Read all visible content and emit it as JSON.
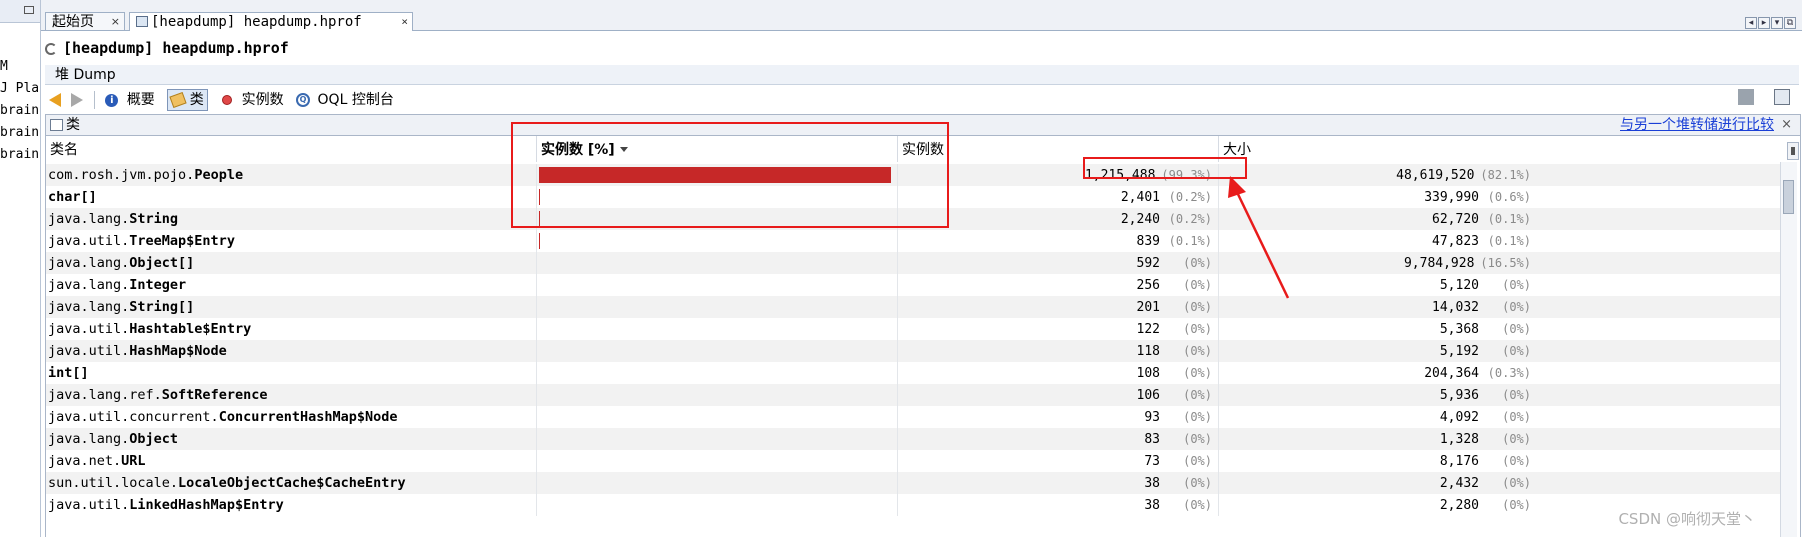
{
  "left_panel": {
    "items": [
      "M",
      "J Pla",
      "brain",
      "brain",
      "brain"
    ]
  },
  "tabs": [
    {
      "label": "起始页",
      "close": "×"
    },
    {
      "label": "[heapdump] heapdump.hprof",
      "close": "×"
    }
  ],
  "tab_nav": [
    "◂",
    "▸",
    "▾",
    "⧉"
  ],
  "window": {
    "title": "[heapdump] heapdump.hprof",
    "subtab": "堆 Dump"
  },
  "toolbar": {
    "summary_label": "概要",
    "classes_label": "类",
    "instances_label": "实例数",
    "oql_label": "OQL 控制台"
  },
  "panel": {
    "title": "类",
    "compare_link": "与另一个堆转储进行比较",
    "close": "×"
  },
  "table": {
    "headers": {
      "name": "类名",
      "instances_pct": "实例数 [%]",
      "instances": "实例数",
      "size": "大小"
    },
    "rows": [
      {
        "pkg": "com.rosh.jvm.pojo.",
        "cls": "People",
        "pct_bar": 99.3,
        "count": "1,215,488",
        "count_pct": "(99.3%)",
        "size": "48,619,520",
        "size_pct": "(82.1%)"
      },
      {
        "pkg": "",
        "cls": "char[]",
        "pct_bar": 0.2,
        "count": "2,401",
        "count_pct": "(0.2%)",
        "size": "339,990",
        "size_pct": "(0.6%)"
      },
      {
        "pkg": "java.lang.",
        "cls": "String",
        "pct_bar": 0.2,
        "count": "2,240",
        "count_pct": "(0.2%)",
        "size": "62,720",
        "size_pct": "(0.1%)"
      },
      {
        "pkg": "java.util.",
        "cls": "TreeMap$Entry",
        "pct_bar": 0.1,
        "count": "839",
        "count_pct": "(0.1%)",
        "size": "47,823",
        "size_pct": "(0.1%)"
      },
      {
        "pkg": "java.lang.",
        "cls": "Object[]",
        "pct_bar": 0,
        "count": "592",
        "count_pct": "(0%)",
        "size": "9,784,928",
        "size_pct": "(16.5%)"
      },
      {
        "pkg": "java.lang.",
        "cls": "Integer",
        "pct_bar": 0,
        "count": "256",
        "count_pct": "(0%)",
        "size": "5,120",
        "size_pct": "(0%)"
      },
      {
        "pkg": "java.lang.",
        "cls": "String[]",
        "pct_bar": 0,
        "count": "201",
        "count_pct": "(0%)",
        "size": "14,032",
        "size_pct": "(0%)"
      },
      {
        "pkg": "java.util.",
        "cls": "Hashtable$Entry",
        "pct_bar": 0,
        "count": "122",
        "count_pct": "(0%)",
        "size": "5,368",
        "size_pct": "(0%)"
      },
      {
        "pkg": "java.util.",
        "cls": "HashMap$Node",
        "pct_bar": 0,
        "count": "118",
        "count_pct": "(0%)",
        "size": "5,192",
        "size_pct": "(0%)"
      },
      {
        "pkg": "",
        "cls": "int[]",
        "pct_bar": 0,
        "count": "108",
        "count_pct": "(0%)",
        "size": "204,364",
        "size_pct": "(0.3%)"
      },
      {
        "pkg": "java.lang.ref.",
        "cls": "SoftReference",
        "pct_bar": 0,
        "count": "106",
        "count_pct": "(0%)",
        "size": "5,936",
        "size_pct": "(0%)"
      },
      {
        "pkg": "java.util.concurrent.",
        "cls": "ConcurrentHashMap$Node",
        "pct_bar": 0,
        "count": "93",
        "count_pct": "(0%)",
        "size": "4,092",
        "size_pct": "(0%)"
      },
      {
        "pkg": "java.lang.",
        "cls": "Object",
        "pct_bar": 0,
        "count": "83",
        "count_pct": "(0%)",
        "size": "1,328",
        "size_pct": "(0%)"
      },
      {
        "pkg": "java.net.",
        "cls": "URL",
        "pct_bar": 0,
        "count": "73",
        "count_pct": "(0%)",
        "size": "8,176",
        "size_pct": "(0%)"
      },
      {
        "pkg": "sun.util.locale.",
        "cls": "LocaleObjectCache$CacheEntry",
        "pct_bar": 0,
        "count": "38",
        "count_pct": "(0%)",
        "size": "2,432",
        "size_pct": "(0%)"
      },
      {
        "pkg": "java.util.",
        "cls": "LinkedHashMap$Entry",
        "pct_bar": 0,
        "count": "38",
        "count_pct": "(0%)",
        "size": "2,280",
        "size_pct": "(0%)"
      }
    ]
  },
  "colors": {
    "bar": "#c62828",
    "annotation": "#e81b1b",
    "link": "#1a3fd6"
  },
  "watermark": "CSDN @响彻天堂丶"
}
